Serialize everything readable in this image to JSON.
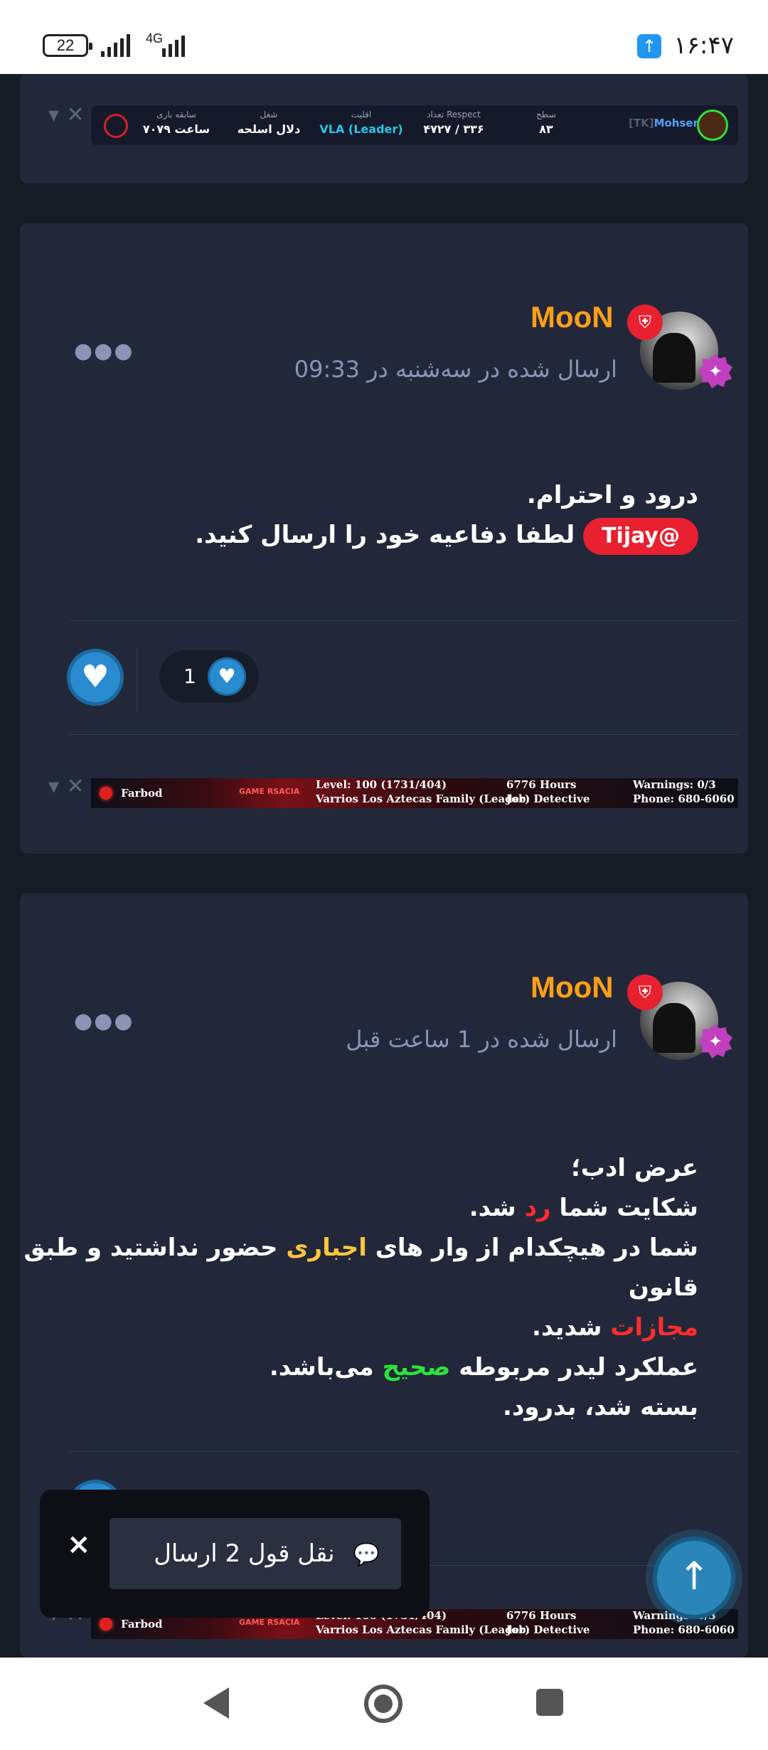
{
  "status_bar": {
    "battery": "22",
    "network": "4G",
    "time": "۱۶:۴۷"
  },
  "top_signature": {
    "name": "Mohsen",
    "prefix": "[TK]",
    "columns": [
      {
        "key": "سطح",
        "value": "۸۳"
      },
      {
        "key": "تعداد Respect",
        "value": "۴۷۲۷ / ۳۳۶"
      },
      {
        "key": "اقلیت",
        "value": "VLA (Leader)"
      },
      {
        "key": "شغل",
        "value": "دلال اسلحه"
      },
      {
        "key": "سابقه بازی",
        "value": "۷۰۷۹ ساعت"
      }
    ]
  },
  "post1": {
    "author": "MooN",
    "posted": "ارسال شده در سه‌شنبه در 09:33",
    "line1": "درود و احترام.",
    "mention": "Tijay@",
    "line2": "لطفا دفاعیه خود را ارسال کنید.",
    "reaction_count": "1"
  },
  "farbod_signature": {
    "name": "Farbod",
    "level": "Level: 100 (1731/404)",
    "family": "Varrios Los Aztecas Family (Leader)",
    "hours": "6776 Hours",
    "job": "Job: Detective",
    "warnings": "Warnings: 0/3",
    "phone": "Phone: 680-6060",
    "logo": "GAME RSACIA"
  },
  "post2": {
    "author": "MooN",
    "posted": "ارسال شده در 1 ساعت قبل",
    "l1": "عرض ادب؛",
    "l2_a": "شکایت شما ",
    "l2_b": "رد",
    "l2_c": " شد.",
    "l3_a": "شما در هیچکدام از وار های ",
    "l3_b": "اجباری",
    "l3_c": " حضور نداشتید و طبق قانون",
    "l4_a": "مجازات",
    "l4_b": " شدید.",
    "l5_a": "عملکرد لیدر مربوطه ",
    "l5_b": "صحیح",
    "l5_c": " می‌باشد.",
    "l6": "بسته شد، بدرود."
  },
  "bottom_signature": {
    "level": "Level: 100 (1731/404)",
    "family": "Varrios Los Aztecas Family (Leader)",
    "hours": "6776 Hours",
    "job": "Job: Detective",
    "warnings": "Warnings: 0/3",
    "phone": "Phone: 680-6060",
    "name": "Farbod"
  },
  "toast": {
    "label": "نقل قول 2 ارسال",
    "close": "×"
  },
  "icons": {
    "more": "more-dots-icon",
    "like": "heart-icon",
    "scroll_top": "arrow-up-icon",
    "quote": "chat-bubbles-icon"
  },
  "colors": {
    "background": "#171b24",
    "card": "#222839",
    "author": "#ff9f1a",
    "mention": "#e8202f",
    "like": "#2a8bd0"
  }
}
